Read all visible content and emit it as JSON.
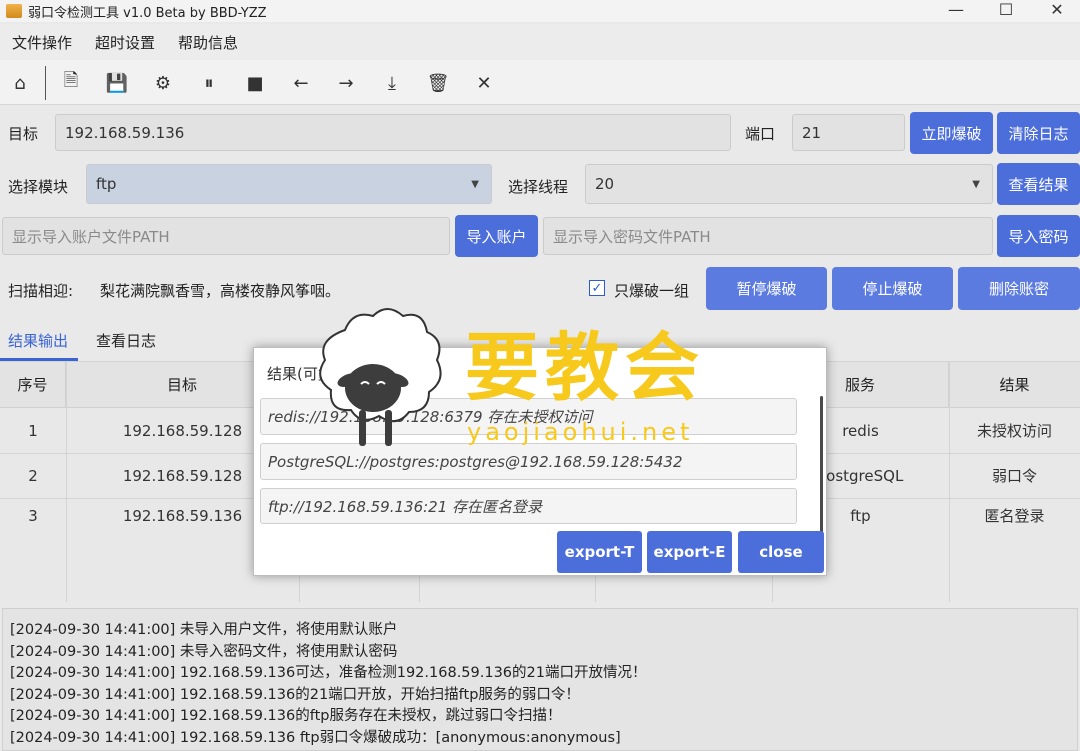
{
  "window": {
    "title": "弱口令检测工具 v1.0 Beta by BBD-YZZ",
    "minimize": "—",
    "maximize": "☐",
    "close": "✕"
  },
  "menu": [
    "文件操作",
    "超时设置",
    "帮助信息"
  ],
  "toolbar": {
    "icons": [
      "home-icon",
      "file-icon",
      "save-icon",
      "gear-icon",
      "pause-icon",
      "stop-icon",
      "arrow-left-icon",
      "arrow-right-icon",
      "download-icon",
      "trash-icon",
      "close-icon"
    ],
    "glyphs": [
      "⌂",
      "🗎",
      "💾",
      "⚙",
      "⏸",
      "■",
      "←",
      "→",
      "⤓",
      "🗑",
      "✕"
    ]
  },
  "target_row": {
    "target_label": "目标",
    "target_value": "192.168.59.136",
    "port_label": "端口",
    "port_value": "21",
    "attack_button": "立即爆破",
    "clear_log_button": "清除日志"
  },
  "module_row": {
    "module_label": "选择模块",
    "module_value": "ftp",
    "thread_label": "选择线程",
    "thread_value": "20",
    "view_result_button": "查看结果"
  },
  "import_row": {
    "user_path_placeholder": "显示导入账户文件PATH",
    "import_user_button": "导入账户",
    "pass_path_placeholder": "显示导入密码文件PATH",
    "import_pass_button": "导入密码"
  },
  "scan_row": {
    "welcome_label": "扫描相迎:",
    "poem": "梨花满院飘香雪，高楼夜静风筝咽。",
    "checkbox_label": "只爆破一组",
    "checkbox_checked": true,
    "checkmark": "✓",
    "pause_button": "暂停爆破",
    "stop_button": "停止爆破",
    "delete_account_button": "删除账密"
  },
  "tabs": [
    "结果输出",
    "查看日志"
  ],
  "table": {
    "headers": [
      "序号",
      "目标",
      "服务",
      "结果"
    ],
    "rows": [
      {
        "no": "1",
        "target": "192.168.59.128",
        "service": "redis",
        "result": "未授权访问"
      },
      {
        "no": "2",
        "target": "192.168.59.128",
        "service": "PostgreSQL",
        "result": "弱口令"
      },
      {
        "no": "3",
        "target": "192.168.59.136",
        "service": "ftp",
        "result": "匿名登录"
      }
    ]
  },
  "log": [
    "[2024-09-30 14:41:00] 未导入用户文件，将使用默认账户",
    "[2024-09-30 14:41:00] 未导入密码文件，将使用默认密码",
    "[2024-09-30 14:41:00] 192.168.59.136可达，准备检测192.168.59.136的21端口开放情况！",
    "[2024-09-30 14:41:00] 192.168.59.136的21端口开放，开始扫描ftp服务的弱口令！",
    "[2024-09-30 14:41:00] 192.168.59.136的ftp服务存在未授权，跳过弱口令扫描！",
    "[2024-09-30 14:41:00] 192.168.59.136 ftp弱口令爆破成功：[anonymous:anonymous]"
  ],
  "dialog": {
    "title": "结果(可复制)",
    "items": [
      "redis://192.168.59.128:6379 存在未授权访问",
      "PostgreSQL://postgres:postgres@192.168.59.128:5432",
      "ftp://192.168.59.136:21 存在匿名登录"
    ],
    "buttons": [
      "export-T",
      "export-E",
      "close"
    ]
  },
  "watermark": {
    "text": "要教会",
    "url": "yaojiaohui.net"
  },
  "colors": {
    "accent": "#4c6edb",
    "watermark": "#f7c91c"
  }
}
